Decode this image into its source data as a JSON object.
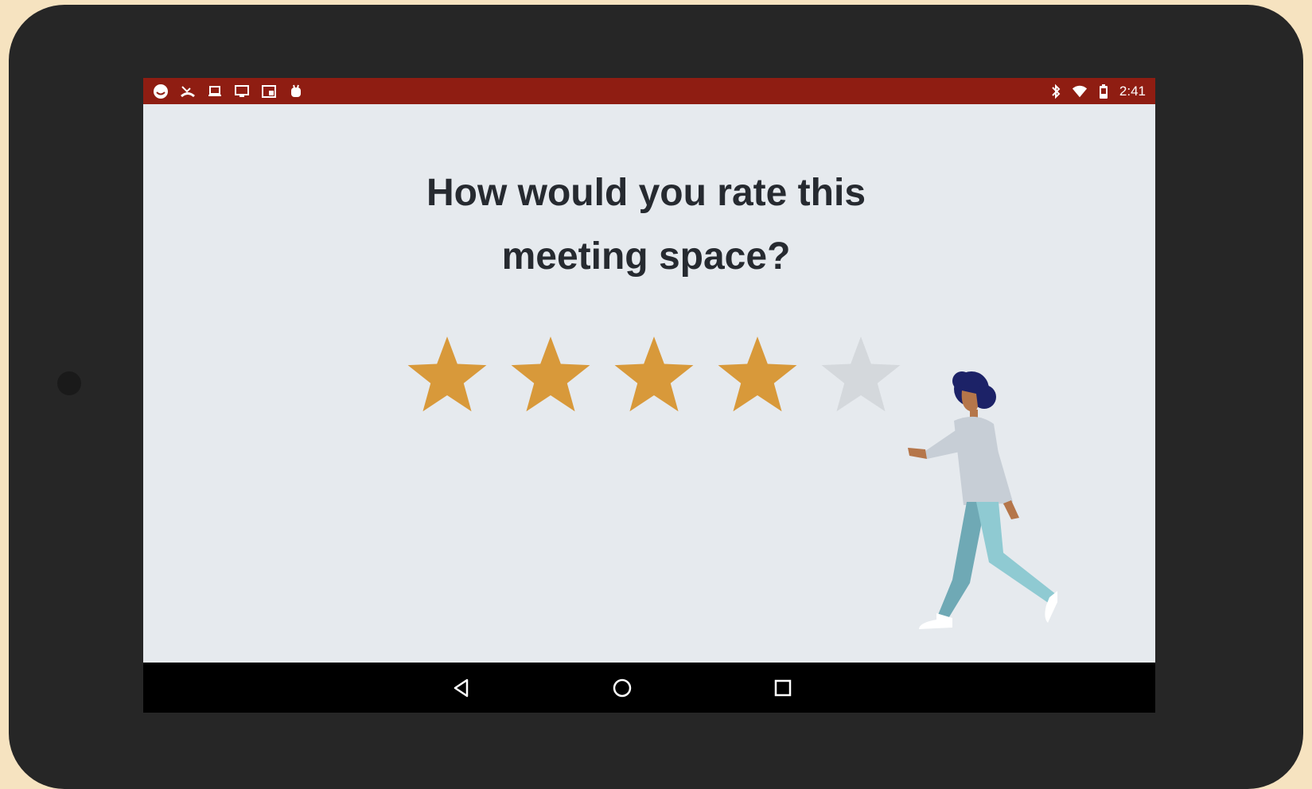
{
  "status_bar": {
    "time": "2:41",
    "left_icons": [
      "face-icon",
      "missed-call-icon",
      "laptop-icon",
      "monitor-icon",
      "window-icon",
      "android-icon"
    ],
    "right_icons": [
      "bluetooth-icon",
      "wifi-icon",
      "battery-icon"
    ],
    "background_color": "#8f1d12"
  },
  "rating": {
    "question_line1": "How would you rate this",
    "question_line2": "meeting space?",
    "value": 4,
    "max": 5,
    "active_color": "#d8993a",
    "inactive_color": "#d4d8dc"
  },
  "nav": {
    "icons": [
      "back-icon",
      "home-icon",
      "recents-icon"
    ]
  }
}
